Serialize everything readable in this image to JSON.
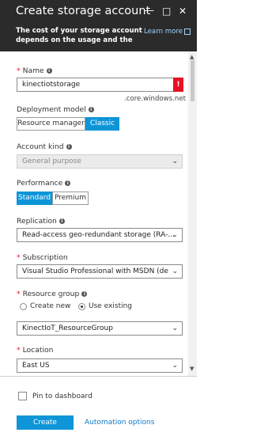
{
  "header": {
    "title": "Create storage account",
    "description": "The cost of your storage account depends on the usage and the",
    "learn_more": "Learn more"
  },
  "form": {
    "name": {
      "label": "Name",
      "value": "kinectiotstorage",
      "error_symbol": "!",
      "suffix": ".core.windows.net"
    },
    "deployment_model": {
      "label": "Deployment model",
      "options": [
        "Resource manager",
        "Classic"
      ],
      "selected": "Classic"
    },
    "account_kind": {
      "label": "Account kind",
      "value": "General purpose"
    },
    "performance": {
      "label": "Performance",
      "options": [
        "Standard",
        "Premium"
      ],
      "selected": "Standard"
    },
    "replication": {
      "label": "Replication",
      "value": "Read-access geo-redundant storage (RA-..."
    },
    "subscription": {
      "label": "Subscription",
      "value": "Visual Studio Professional with MSDN (de"
    },
    "resource_group": {
      "label": "Resource group",
      "options": [
        "Create new",
        "Use existing"
      ],
      "selected": "Use existing",
      "value": "KinectIoT_ResourceGroup"
    },
    "location": {
      "label": "Location",
      "value": "East US"
    }
  },
  "footer": {
    "pin_label": "Pin to dashboard",
    "pin_checked": false,
    "create_label": "Create",
    "automation_label": "Automation options"
  },
  "colors": {
    "accent": "#0e95d8",
    "header_bg": "#2b2b2b",
    "error": "#e81123"
  }
}
